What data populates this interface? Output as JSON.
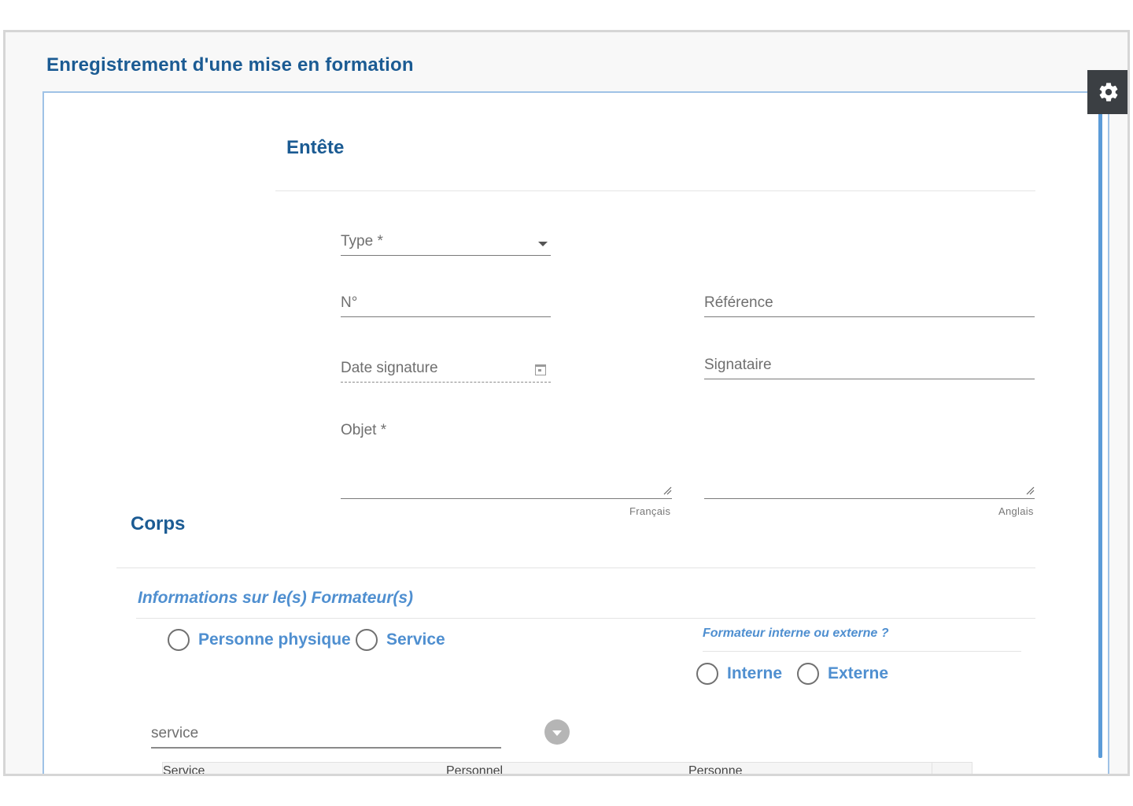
{
  "page": {
    "title": "Enregistrement d'une mise en formation"
  },
  "entete": {
    "title": "Entête",
    "type_label": "Type *",
    "numero_label": "N°",
    "reference_label": "Référence",
    "date_signature_label": "Date signature",
    "signataire_label": "Signataire",
    "objet_label": "Objet *",
    "lang_fr": "Français",
    "lang_en": "Anglais"
  },
  "corps": {
    "title": "Corps",
    "formateurs_title": "Informations sur le(s) Formateur(s)",
    "radio_personne": "Personne physique",
    "radio_service": "Service",
    "interne_externe_question": "Formateur interne ou externe ?",
    "radio_interne": "Interne",
    "radio_externe": "Externe",
    "service_field_value": "service",
    "table_headers": [
      "Service",
      "Personnel",
      "Personne"
    ]
  },
  "colors": {
    "accent": "#1b5b93",
    "link": "#4f8fd0",
    "toolbar": "#3b3f43"
  }
}
